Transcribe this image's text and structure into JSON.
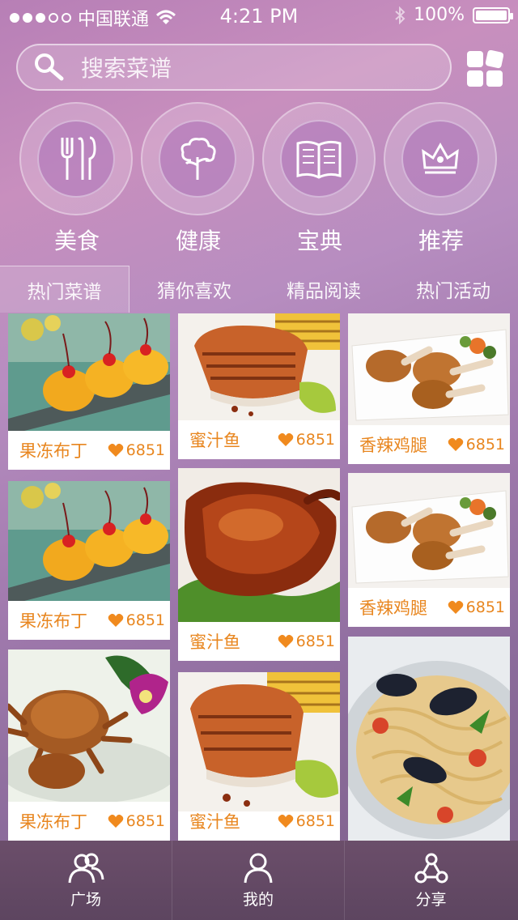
{
  "status_bar": {
    "carrier": "中国联通",
    "time": "4:21 PM",
    "battery": "100%"
  },
  "search": {
    "placeholder": "搜索菜谱"
  },
  "categories": [
    {
      "label": "美食",
      "icon": "utensils-icon"
    },
    {
      "label": "健康",
      "icon": "tree-icon"
    },
    {
      "label": "宝典",
      "icon": "book-icon"
    },
    {
      "label": "推荐",
      "icon": "crown-icon"
    }
  ],
  "tabs": [
    "热门菜谱",
    "猜你喜欢",
    "精品阅读",
    "热门活动"
  ],
  "recipes": {
    "col1": [
      {
        "name": "果冻布丁",
        "likes": "6851",
        "image": "jelly-pudding"
      },
      {
        "name": "果冻布丁",
        "likes": "6851",
        "image": "jelly-pudding"
      },
      {
        "name": "果冻布丁",
        "likes": "6851",
        "image": "crab"
      }
    ],
    "col2": [
      {
        "name": "蜜汁鱼",
        "likes": "6851",
        "image": "salmon"
      },
      {
        "name": "蜜汁鱼",
        "likes": "6851",
        "image": "roast-duck"
      },
      {
        "name": "蜜汁鱼",
        "likes": "6851",
        "image": "salmon"
      }
    ],
    "col3": [
      {
        "name": "香辣鸡腿",
        "likes": "6851",
        "image": "chicken-legs"
      },
      {
        "name": "香辣鸡腿",
        "likes": "6851",
        "image": "chicken-legs"
      },
      {
        "name": "",
        "likes": "",
        "image": "seafood-pasta"
      }
    ]
  },
  "tabbar": [
    {
      "label": "广场",
      "icon": "people-icon"
    },
    {
      "label": "我的",
      "icon": "person-icon"
    },
    {
      "label": "分享",
      "icon": "share-icon"
    }
  ],
  "colors": {
    "accent": "#e8861f",
    "background": "#b58ab9",
    "tabbar": "#634a64"
  }
}
